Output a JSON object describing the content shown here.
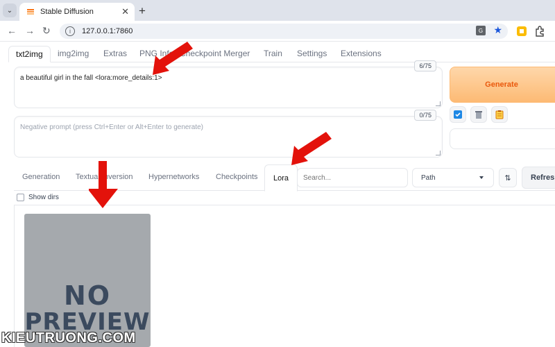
{
  "browser": {
    "tab_title": "Stable Diffusion",
    "url": "127.0.0.1:7860"
  },
  "app_tabs": [
    "txt2img",
    "img2img",
    "Extras",
    "PNG Info",
    "Checkpoint Merger",
    "Train",
    "Settings",
    "Extensions"
  ],
  "prompt": {
    "value": "a beautiful girl in the fall <lora:more_details:1>",
    "token_count": "6/75"
  },
  "negative_prompt": {
    "placeholder": "Negative prompt (press Ctrl+Enter or Alt+Enter to generate)",
    "token_count": "0/75"
  },
  "generate_label": "Generate",
  "extra_networks": {
    "tabs": [
      "Generation",
      "Textual Inversion",
      "Hypernetworks",
      "Checkpoints",
      "Lora"
    ],
    "search_placeholder": "Search...",
    "sort_select": "Path",
    "refresh_label": "Refresh",
    "show_dirs_label": "Show dirs"
  },
  "card": {
    "preview_line1": "NO",
    "preview_line2": "PREVIEW"
  },
  "watermark": "KIEUTRUONG.COM",
  "colors": {
    "accent_orange": "#ea580c",
    "arrow_red": "#e3120b",
    "card_gray": "#a5a9ad"
  }
}
